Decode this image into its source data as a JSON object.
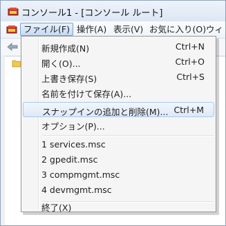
{
  "window": {
    "title": "コンソール1 - [コンソール ルート]"
  },
  "menubar": {
    "items": [
      {
        "label": "ファイル(F)"
      },
      {
        "label": "操作(A)"
      },
      {
        "label": "表示(V)"
      },
      {
        "label": "お気に入り(O)"
      },
      {
        "label": "ウィ"
      }
    ]
  },
  "file_menu": {
    "items": [
      {
        "label": "新規作成(N)",
        "shortcut": "Ctrl+N"
      },
      {
        "label": "開く(O)...",
        "shortcut": "Ctrl+O"
      },
      {
        "label": "上書き保存(S)",
        "shortcut": "Ctrl+S"
      },
      {
        "label": "名前を付けて保存(A)...",
        "shortcut": ""
      },
      {
        "label": "スナップインの追加と削除(M)...",
        "shortcut": "Ctrl+M"
      },
      {
        "label": "オプション(P)...",
        "shortcut": ""
      },
      {
        "label": "1 services.msc",
        "shortcut": ""
      },
      {
        "label": "2 gpedit.msc",
        "shortcut": ""
      },
      {
        "label": "3 compmgmt.msc",
        "shortcut": ""
      },
      {
        "label": "4 devmgmt.msc",
        "shortcut": ""
      },
      {
        "label": "終了(X)",
        "shortcut": ""
      }
    ]
  },
  "colors": {
    "highlight_border": "#a8c8ec",
    "menu_background": "#f5f5f5",
    "title_gradient_top": "#eef3fa"
  },
  "icons": [
    "mmc-app-icon",
    "back-arrow-icon",
    "folder-icon"
  ]
}
